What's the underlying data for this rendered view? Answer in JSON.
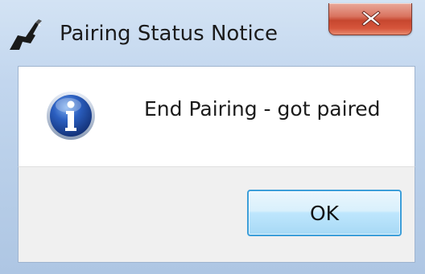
{
  "window": {
    "title": "Pairing Status Notice"
  },
  "titlebar": {
    "app_icon": "pen-hand-icon",
    "close_icon": "close-icon"
  },
  "content": {
    "icon": "info-icon",
    "message": "End Pairing - got paired"
  },
  "footer": {
    "ok_label": "OK"
  },
  "colors": {
    "close_button": "#c6472f",
    "ok_border": "#3c9ed9",
    "info_icon": "#1f4fa8",
    "frame": "#b9cfe9"
  }
}
